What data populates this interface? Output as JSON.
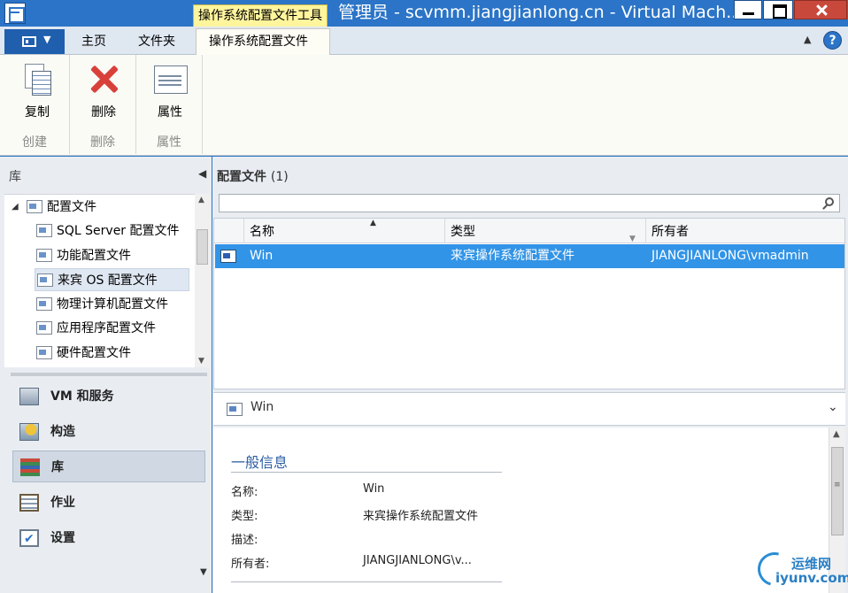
{
  "window": {
    "title": "管理员 - scvmm.jiangjianlong.cn - Virtual Mach...",
    "tool_tab_title": "操作系统配置文件工具"
  },
  "ribbon": {
    "tabs": [
      "主页",
      "文件夹",
      "操作系统配置文件"
    ],
    "groups": [
      {
        "label": "创建",
        "button": "复制",
        "icon": "copy-icon"
      },
      {
        "label": "删除",
        "button": "删除",
        "icon": "delete-icon"
      },
      {
        "label": "属性",
        "button": "属性",
        "icon": "properties-icon"
      }
    ]
  },
  "left_panel": {
    "header": "库",
    "tree_root": "配置文件",
    "tree_items": [
      "SQL Server 配置文件",
      "功能配置文件",
      "来宾 OS 配置文件",
      "物理计算机配置文件",
      "应用程序配置文件",
      "硬件配置文件"
    ],
    "selected_tree_item": "来宾 OS 配置文件",
    "nav": [
      {
        "label": "VM 和服务",
        "icon": "vm-services-icon"
      },
      {
        "label": "构造",
        "icon": "fabric-icon"
      },
      {
        "label": "库",
        "icon": "library-icon"
      },
      {
        "label": "作业",
        "icon": "jobs-icon"
      },
      {
        "label": "设置",
        "icon": "settings-icon"
      }
    ],
    "active_nav": "库"
  },
  "main": {
    "title": "配置文件",
    "count": "(1)",
    "search_placeholder": "",
    "columns": [
      "名称",
      "类型",
      "所有者"
    ],
    "rows": [
      {
        "name": "Win",
        "type": "来宾操作系统配置文件",
        "owner": "JIANGJIANLONG\\vmadmin"
      }
    ]
  },
  "detail": {
    "header_name": "Win",
    "section": "一般信息",
    "props": [
      {
        "label": "名称:",
        "value": "Win"
      },
      {
        "label": "类型:",
        "value": "来宾操作系统配置文件"
      },
      {
        "label": "描述:",
        "value": ""
      },
      {
        "label": "所有者:",
        "value": "JIANGJIANLONG\\v..."
      }
    ]
  },
  "watermark": {
    "line1": "运维网",
    "line2": "iyunv.com"
  }
}
